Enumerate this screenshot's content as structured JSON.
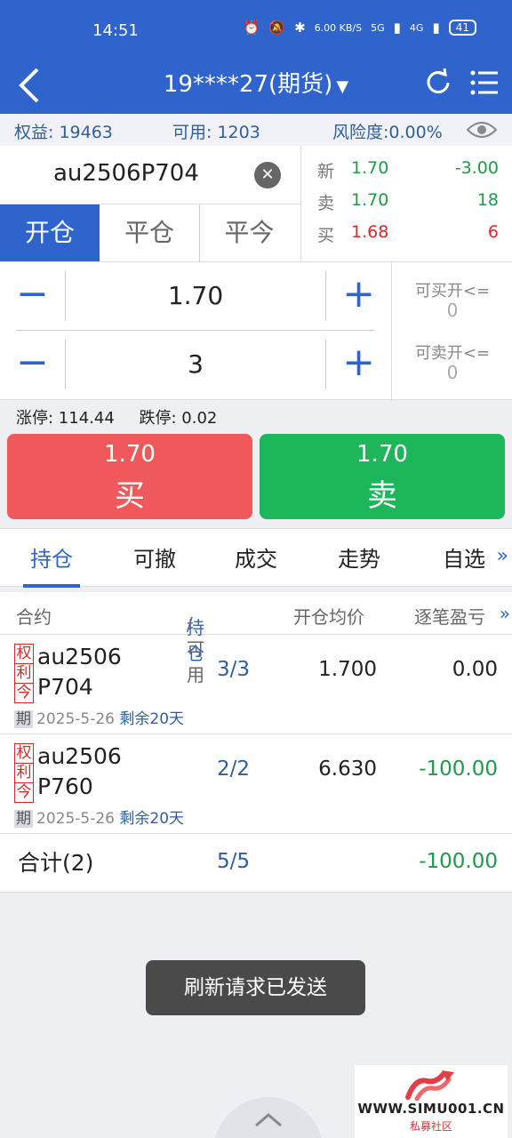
{
  "status_bar": {
    "time": "14:51",
    "network_speed": "6.00 KB/S",
    "signal_5g": "5G",
    "signal_4g": "4G",
    "battery": "41"
  },
  "nav": {
    "title": "19****27(期货)",
    "caret": "▼",
    "back_icon": "chevron-left-icon",
    "refresh_icon": "refresh-icon",
    "menu_icon": "list-menu-icon"
  },
  "account": {
    "equity": "权益: 19463",
    "available": "可用: 1203",
    "risk": "风险度:0.00%"
  },
  "order": {
    "symbol": "au2506P704",
    "tabs": [
      "开仓",
      "平仓",
      "平今"
    ],
    "price": "1.70",
    "quantity": "3",
    "can_buy_label": "可买开<=",
    "can_buy_value": "0",
    "can_sell_label": "可卖开<=",
    "can_sell_value": "0"
  },
  "quote": {
    "rows": [
      {
        "label": "新",
        "price": "1.70",
        "value": "-3.00"
      },
      {
        "label": "卖",
        "price": "1.70",
        "value": "18"
      },
      {
        "label": "买",
        "price": "1.68",
        "value": "6"
      }
    ]
  },
  "limits": {
    "up": "涨停: 114.44",
    "down": "跌停: 0.02"
  },
  "buttons": {
    "buy_price": "1.70",
    "buy_label": "买",
    "sell_price": "1.70",
    "sell_label": "卖"
  },
  "subtabs": [
    "持仓",
    "可撤",
    "成交",
    "走势",
    "自选"
  ],
  "subtabs_more": "»",
  "table": {
    "headers": {
      "contract": "合约",
      "position_hl": "持仓",
      "position_rest": "/可用",
      "avg_price": "开仓均价",
      "pnl": "逐笔盈亏",
      "more": "»"
    },
    "tag_labels": [
      "权",
      "利",
      "今"
    ],
    "rows": [
      {
        "name_l1": "au2506",
        "name_l2": "P704",
        "qi": "期",
        "date": "2025-5-26",
        "remaining": "剩余20天",
        "qty": "3/3",
        "avg": "1.700",
        "pnl": "0.00"
      },
      {
        "name_l1": "au2506",
        "name_l2": "P760",
        "qi": "期",
        "date": "2025-5-26",
        "remaining": "剩余20天",
        "qty": "2/2",
        "avg": "6.630",
        "pnl": "-100.00"
      }
    ],
    "total": {
      "label": "合计(2)",
      "qty": "5/5",
      "pnl": "-100.00"
    }
  },
  "toast": "刷新请求已发送",
  "watermark": {
    "text": "WWW.SIMU001.CN",
    "sub": "私募社区"
  },
  "colors": {
    "primary": "#2f64cd",
    "buy": "#f0595b",
    "sell": "#1db65b",
    "down": "#1f9a4a",
    "up_red": "#d42a2a"
  }
}
